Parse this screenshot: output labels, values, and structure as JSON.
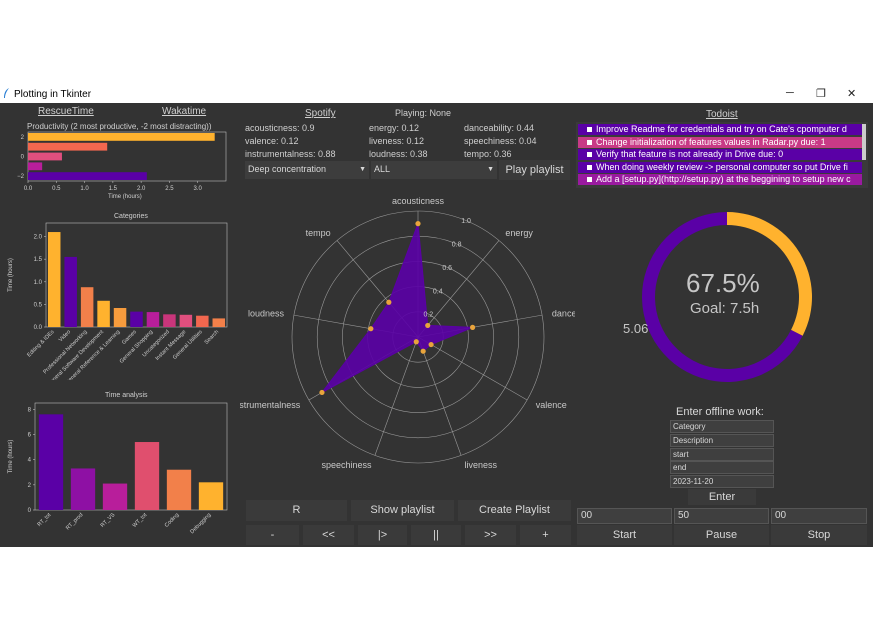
{
  "window": {
    "title": "Plotting in Tkinter",
    "min": "─",
    "max": "❐",
    "close": "✕"
  },
  "nav": {
    "rescuetime": "RescueTime",
    "wakatime": "Wakatime",
    "spotify": "Spotify",
    "playing": "Playing: None",
    "todoist": "Todoist"
  },
  "productivity_chart": {
    "title": "Productivity (2 most productive, -2 most distracting))",
    "xlabel": "Time (hours)",
    "xticks": [
      "0.0",
      "0.5",
      "1.0",
      "1.5",
      "2.0",
      "2.5",
      "3.0"
    ],
    "yticks": [
      "2",
      "0",
      "−2"
    ],
    "chart_data": {
      "type": "bar",
      "orientation": "horizontal",
      "categories": [
        2,
        1,
        0,
        -1,
        -2
      ],
      "values": [
        3.3,
        1.4,
        0.6,
        0.25,
        2.1
      ],
      "colors": [
        "#ffb22e",
        "#f2674f",
        "#e04f7e",
        "#b81e9b",
        "#5a00a6"
      ],
      "xlim": [
        0,
        3.5
      ]
    }
  },
  "categories_chart": {
    "title": "Categories",
    "ylabel": "Time (hours)",
    "yticks": [
      "0.0",
      "0.5",
      "1.0",
      "1.5",
      "2.0"
    ],
    "chart_data": {
      "type": "bar",
      "categories": [
        "Editing & IDEs",
        "Video",
        "Professional Networking",
        "General Software Development",
        "General Reference & Learning",
        "Games",
        "General Shopping",
        "Uncategorized",
        "Instant Message",
        "General Utilities",
        "Search"
      ],
      "values": [
        2.1,
        1.55,
        0.88,
        0.58,
        0.42,
        0.34,
        0.33,
        0.28,
        0.27,
        0.25,
        0.19
      ],
      "colors": [
        "#ffb22e",
        "#5a00a6",
        "#f2804a",
        "#ffb22e",
        "#f79c3d",
        "#5a00a6",
        "#b81e9b",
        "#c9357b",
        "#e04f7e",
        "#f2674f",
        "#f2804a"
      ],
      "ylim": [
        0,
        2.3
      ]
    }
  },
  "time_chart": {
    "title": "Time analysis",
    "ylabel": "Time (hours)",
    "yticks": [
      "0",
      "2",
      "4",
      "6",
      "8"
    ],
    "chart_data": {
      "type": "bar",
      "categories": [
        "RT_tot",
        "RT_prod",
        "RT_VS",
        "WT_tot",
        "Coding",
        "Debugging"
      ],
      "values": [
        7.6,
        3.3,
        2.1,
        5.4,
        3.2,
        2.2
      ],
      "colors": [
        "#5a00a6",
        "#8e10a4",
        "#b81e9b",
        "#e04f6e",
        "#f2804a",
        "#ffb22e"
      ],
      "ylim": [
        0,
        8.5
      ]
    }
  },
  "features": {
    "acousticness": "acousticness: 0.9",
    "energy": "energy: 0.12",
    "danceability": "danceability: 0.44",
    "valence": "valence: 0.12",
    "liveness": "liveness: 0.12",
    "speechiness": "speechiness: 0.04",
    "instrumentalness": "instrumentalness: 0.88",
    "loudness": "loudness: 0.38",
    "tempo": "tempo: 0.36"
  },
  "controls": {
    "playlist_select": "Deep concentration",
    "genre_select": "ALL",
    "play_playlist": "Play playlist",
    "dropdown_icon": "triangle-down-icon"
  },
  "radar": {
    "labels": [
      "acousticness",
      "energy",
      "danceability",
      "valence",
      "liveness",
      "speechiness",
      "instrumentalness",
      "loudness",
      "tempo"
    ],
    "ticks": [
      "0.2",
      "0.4",
      "0.6",
      "0.8",
      "1.0"
    ],
    "chart_data": {
      "type": "radar",
      "axes": [
        "acousticness",
        "energy",
        "danceability",
        "valence",
        "liveness",
        "speechiness",
        "instrumentalness",
        "loudness",
        "tempo"
      ],
      "values": [
        0.9,
        0.12,
        0.44,
        0.12,
        0.12,
        0.04,
        0.88,
        0.38,
        0.36
      ],
      "fill": "#5a00a6",
      "marker": "#e8a43c",
      "rlim": [
        0,
        1
      ]
    }
  },
  "buttons": {
    "r": "R",
    "show_playlist": "Show playlist",
    "create_playlist": "Create Playlist",
    "minus": "-",
    "rewind": "<<",
    "play": "|>",
    "pause_icon": "||",
    "forward": ">>",
    "plus": "+"
  },
  "todos": [
    {
      "text": "Improve Readme for credentials and try on Cate's cpomputer d",
      "color": "#5a00a6"
    },
    {
      "text": "Change initialization of features values in Radar.py due: 1",
      "color": "#c83a86"
    },
    {
      "text": "Verify that feature is not already in Drive due: 0",
      "color": "#5a00a6"
    },
    {
      "text": "When doing weekly review -> personal computer so put Drive fi",
      "color": "#5a00a6"
    },
    {
      "text": "Add a [setup.py](http://setup.py) at the beggining to setup new c",
      "color": "#9a1aa0"
    }
  ],
  "goal": {
    "percent_text": "67.5%",
    "goal_text": "Goal: 7.5h",
    "done_text": "5.06",
    "chart_data": {
      "type": "pie",
      "values": [
        5.06,
        2.44
      ],
      "colors": [
        "#5a00a6",
        "#ffb22e"
      ],
      "total": 7.5
    }
  },
  "offline": {
    "title": "Enter offline work:",
    "category": "Category",
    "description": "Description",
    "start": "start",
    "end": "end",
    "date": "2023-11-20",
    "enter": "Enter"
  },
  "timer": {
    "hours": "00",
    "minutes": "50",
    "seconds": "00",
    "start": "Start",
    "pause": "Pause",
    "stop": "Stop"
  }
}
